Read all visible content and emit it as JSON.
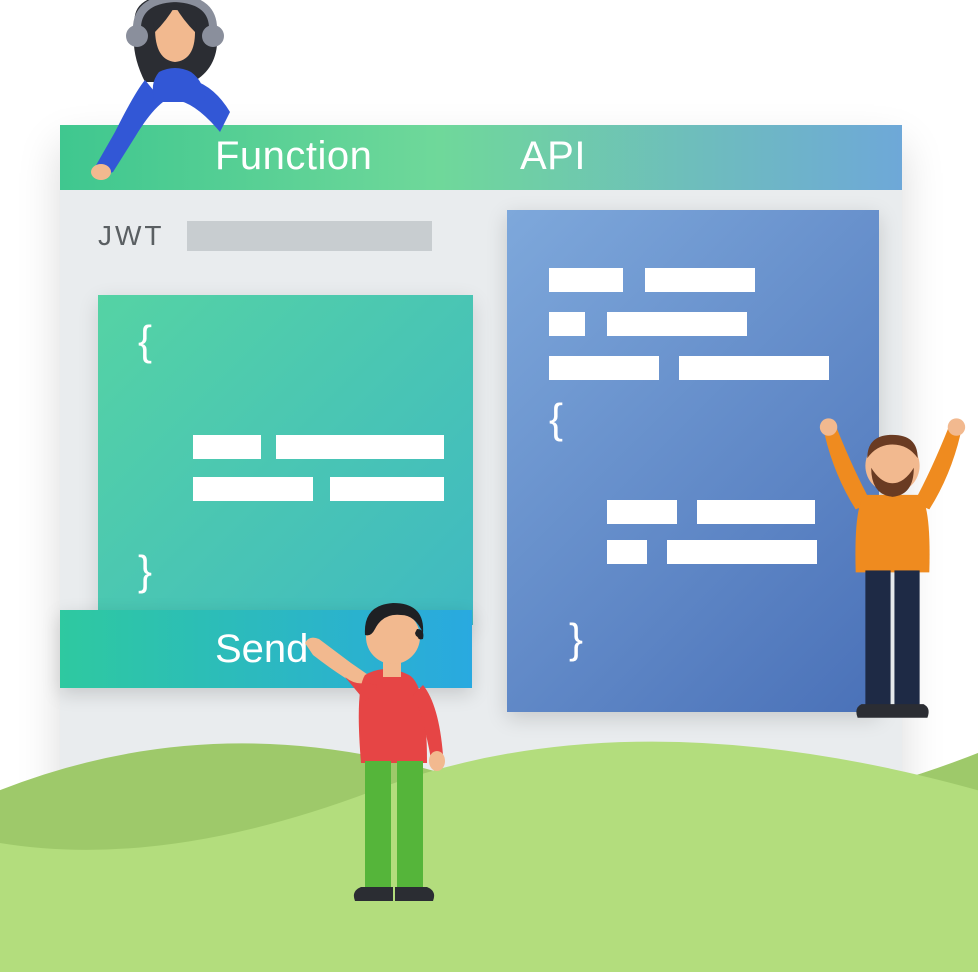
{
  "header": {
    "tab_function": "Function",
    "tab_api": "API"
  },
  "jwt": {
    "label": "JWT",
    "value": ""
  },
  "function_panel": {
    "brace_open": "{",
    "brace_close": "}"
  },
  "api_panel": {
    "brace_open": "{",
    "brace_close": "}"
  },
  "actions": {
    "send": "Send"
  }
}
